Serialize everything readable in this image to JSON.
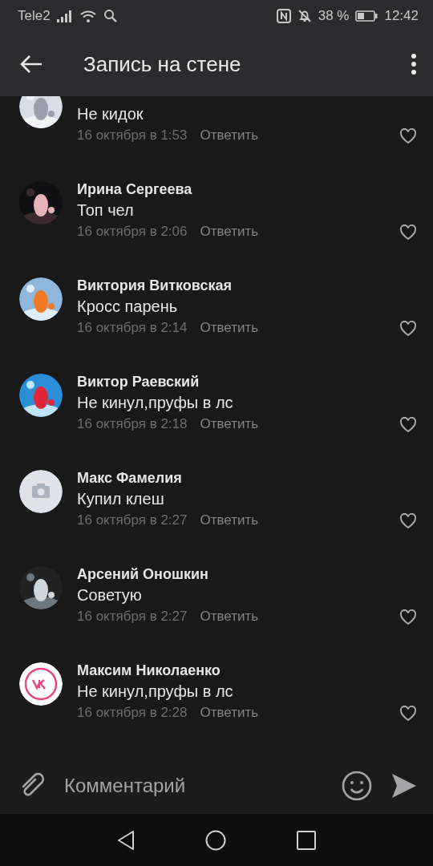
{
  "status_bar": {
    "carrier": "Tele2",
    "battery": "38 %",
    "time": "12:42"
  },
  "header": {
    "title": "Запись на стене"
  },
  "comments": [
    {
      "kind": "picture",
      "text": "Не кидок",
      "date": "16 октября в 1:53",
      "reply": "Ответить"
    },
    {
      "kind": "picture",
      "name": "Ирина Сергеева",
      "text": "Топ чел",
      "date": "16 октября в 2:06",
      "reply": "Ответить"
    },
    {
      "kind": "picture",
      "name": "Виктория Витковская",
      "text": "Кросс парень",
      "date": "16 октября в 2:14",
      "reply": "Ответить"
    },
    {
      "kind": "picture",
      "name": "Виктор Раевский",
      "text": "Не кинул,пруфы в лс",
      "date": "16 октября в 2:18",
      "reply": "Ответить"
    },
    {
      "kind": "camera",
      "name": "Макс Фамелия",
      "text": "Купил клеш",
      "date": "16 октября в 2:27",
      "reply": "Ответить"
    },
    {
      "kind": "picture",
      "name": "Арсений Оношкин",
      "text": "Советую",
      "date": "16 октября в 2:27",
      "reply": "Ответить"
    },
    {
      "kind": "vk",
      "name": "Максим Николаенко",
      "text": "Не кинул,пруфы в лс",
      "date": "16 октября в 2:28",
      "reply": "Ответить"
    }
  ],
  "composer": {
    "placeholder": "Комментарий"
  }
}
